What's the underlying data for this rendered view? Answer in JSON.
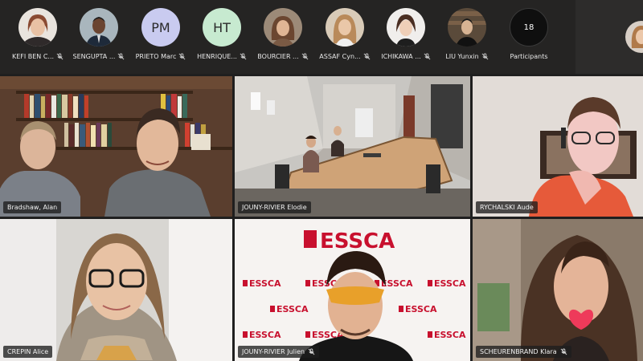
{
  "participants": [
    {
      "name": "KEFI BEN C...",
      "avatar_color": "#b8846a"
    },
    {
      "name": "SENGUPTA ...",
      "avatar_color": "#5a6d7a"
    },
    {
      "name": "PRIETO Marc",
      "initials": "PM",
      "avatar_color": "#c9cbf0"
    },
    {
      "name": "HENRIQUE...",
      "initials": "HT",
      "avatar_color": "#c7ead0"
    },
    {
      "name": "BOURCIER ...",
      "avatar_color": "#8a6a55"
    },
    {
      "name": "ASSAF Cyn...",
      "avatar_color": "#c49a74"
    },
    {
      "name": "ICHIKAWA ...",
      "avatar_color": "#d8d4d0"
    },
    {
      "name": "LIU Yunxin",
      "avatar_color": "#4a4a4a"
    }
  ],
  "participant_count": {
    "value": "18",
    "label": "Participants"
  },
  "videos": [
    {
      "name": "Bradshaw, Alan",
      "selected": true
    },
    {
      "name": "JOUNY-RIVIER Elodie",
      "selected": true
    },
    {
      "name": "RYCHALSKI Aude",
      "selected": false
    },
    {
      "name": "CREPIN Alice",
      "selected": false
    },
    {
      "name": "JOUNY-RIVIER Julien",
      "selected": false
    },
    {
      "name": "SCHEURENBRAND Klara",
      "selected": false
    }
  ],
  "backdrop": {
    "brand": "ESSCA",
    "brand_color": "#c8102e"
  },
  "colors": {
    "strip_bg": "#252423",
    "selected_outline": "#6f70c8",
    "app_bg": "#1f1f1f"
  }
}
